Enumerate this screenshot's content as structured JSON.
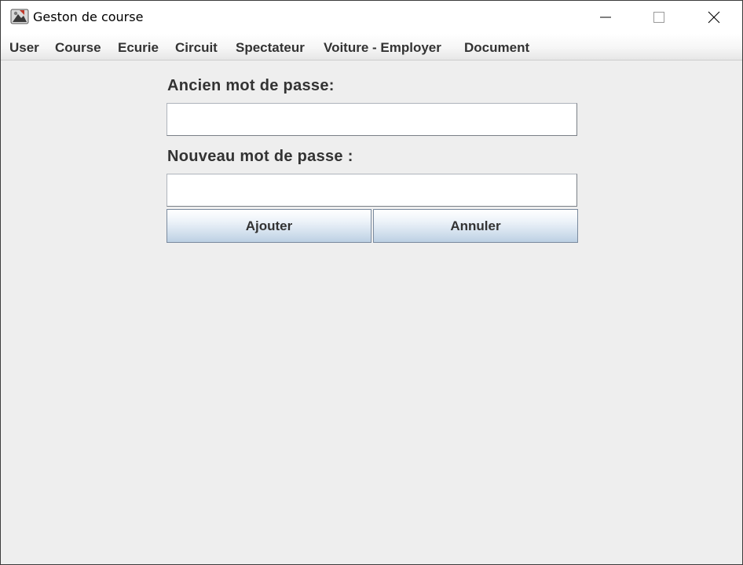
{
  "window": {
    "title": "Geston de course",
    "icons": {
      "app": "app-icon",
      "minimize": "minimize-icon",
      "maximize": "maximize-icon",
      "close": "close-icon"
    }
  },
  "menubar": {
    "items": [
      {
        "label": "User"
      },
      {
        "label": "Course"
      },
      {
        "label": "Ecurie"
      },
      {
        "label": "Circuit"
      },
      {
        "label": "Spectateur"
      },
      {
        "label": "Voiture - Employer"
      },
      {
        "label": "Document"
      }
    ]
  },
  "form": {
    "old_password": {
      "label": "Ancien mot de passe:",
      "value": ""
    },
    "new_password": {
      "label": "Nouveau mot de passe :",
      "value": ""
    },
    "buttons": {
      "add": "Ajouter",
      "cancel": "Annuler"
    }
  },
  "colors": {
    "window_background": "#eeeeee",
    "text": "#333333",
    "button_gradient_top": "#ffffff",
    "button_gradient_bottom": "#bcd0e3"
  }
}
